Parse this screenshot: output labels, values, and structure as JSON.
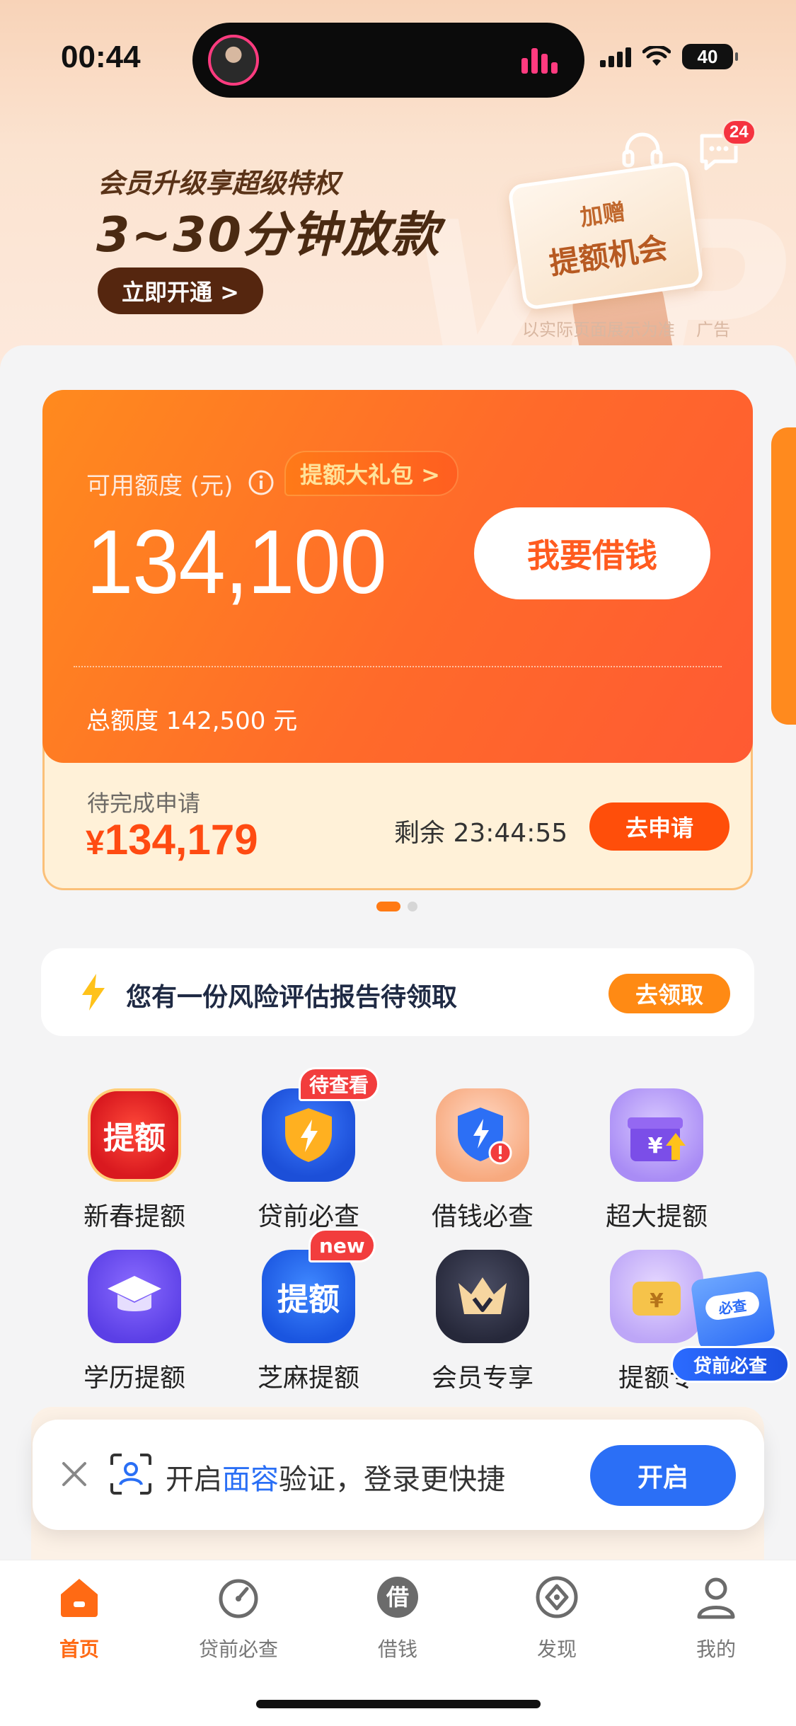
{
  "status_bar": {
    "time": "00:44",
    "battery": "40"
  },
  "header": {
    "message_badge": "24"
  },
  "promo": {
    "subtitle": "会员升级享超级特权",
    "headline": "3~30分钟放款",
    "cta": "立即开通 >",
    "card_line1": "加赠",
    "card_line2": "提额机会",
    "disclaimer": "以实际页面展示为准",
    "ad_tag": "广告"
  },
  "credit": {
    "available_label": "可用额度 (元)",
    "gift_pill": "提额大礼包 >",
    "available_amount": "134,100",
    "borrow_button": "我要借钱",
    "total_label": "总额度 142,500 元"
  },
  "pending": {
    "label": "待完成申请",
    "currency": "¥",
    "amount": "134,179",
    "countdown": "剩余 23:44:55",
    "apply_button": "去申请"
  },
  "risk": {
    "text": "您有一份风险评估报告待领取",
    "button": "去领取"
  },
  "features": [
    {
      "label": "新春提额",
      "icon_text": "提额",
      "icon": "quota-red-icon"
    },
    {
      "label": "贷前必查",
      "badge": "待查看",
      "icon": "shield-bolt-icon"
    },
    {
      "label": "借钱必查",
      "icon": "shield-alert-icon"
    },
    {
      "label": "超大提额",
      "icon": "gift-box-icon"
    },
    {
      "label": "学历提额",
      "icon": "graduation-cap-icon"
    },
    {
      "label": "芝麻提额",
      "icon_text": "提额",
      "badge": "new",
      "icon": "quota-blue-icon"
    },
    {
      "label": "会员专享",
      "icon": "crown-icon"
    },
    {
      "label": "提额专",
      "icon": "wallet-icon"
    }
  ],
  "float_badge": {
    "doc_text": "必查",
    "label": "贷前必查"
  },
  "face_prompt": {
    "prefix": "开启",
    "highlight": "面容",
    "suffix": "验证，登录更快捷",
    "button": "开启"
  },
  "tabs": [
    {
      "label": "首页",
      "icon": "home-icon",
      "active": true
    },
    {
      "label": "贷前必查",
      "icon": "gauge-icon"
    },
    {
      "label": "借钱",
      "icon": "borrow-icon",
      "icon_text": "借"
    },
    {
      "label": "发现",
      "icon": "compass-icon"
    },
    {
      "label": "我的",
      "icon": "profile-icon"
    }
  ]
}
